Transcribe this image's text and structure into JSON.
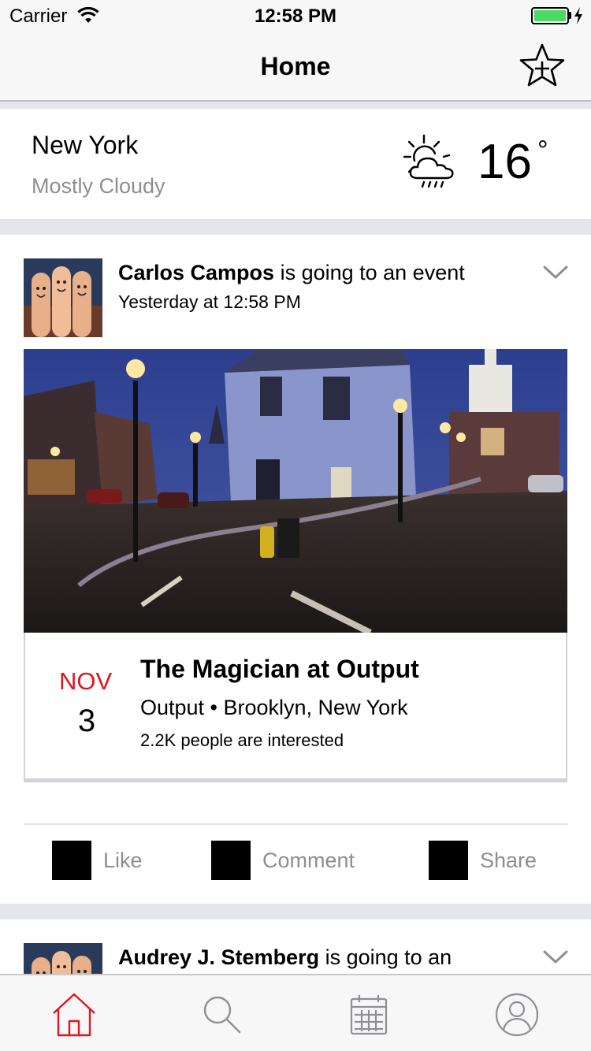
{
  "status_bar": {
    "carrier": "Carrier",
    "time": "12:58 PM",
    "battery_level": 1.0,
    "battery_color": "#4cd964"
  },
  "nav": {
    "title": "Home",
    "right_icon": "star-plus-icon"
  },
  "weather": {
    "city": "New York",
    "condition": "Mostly Cloudy",
    "temperature": "16",
    "degree_symbol": "°",
    "icon": "sun-cloud-rain-icon"
  },
  "feed": [
    {
      "user": "Carlos Campos",
      "action": " is going to an event",
      "time": "Yesterday at 12:58 PM",
      "event": {
        "month": "NOV",
        "day": "3",
        "title": "The Magician at Output",
        "venue": "Output • Brooklyn, New York",
        "interest": "2.2K people are interested"
      },
      "actions": {
        "like": "Like",
        "comment": "Comment",
        "share": "Share"
      }
    },
    {
      "user": "Audrey J. Stemberg",
      "action": " is going to an"
    }
  ],
  "tabs": [
    {
      "icon": "home-icon",
      "active": true
    },
    {
      "icon": "search-icon",
      "active": false
    },
    {
      "icon": "calendar-icon",
      "active": false
    },
    {
      "icon": "profile-icon",
      "active": false
    }
  ],
  "colors": {
    "accent": "#e0161e",
    "secondary_text": "#8e8e93",
    "background": "#e5e6ea"
  }
}
